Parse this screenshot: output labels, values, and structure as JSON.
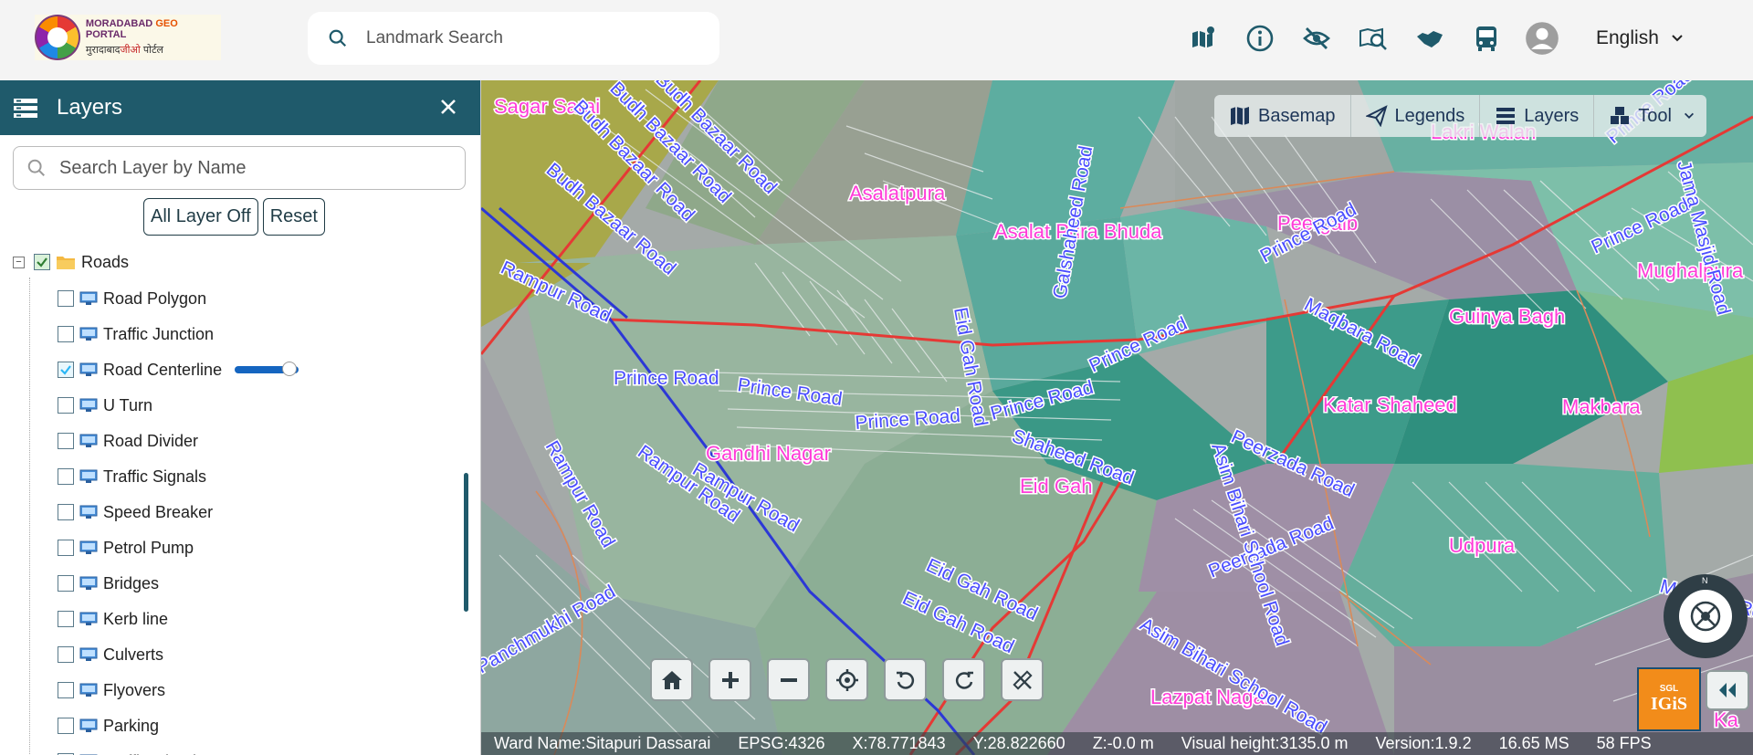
{
  "header": {
    "logo_line1_a": "MORADABAD",
    "logo_line1_b": "GEO",
    "logo_line1_c": "PORTAL",
    "logo_line2_a": "मुरादाबाद",
    "logo_line2_b": "जीओ",
    "logo_line2_c": "पोर्टल",
    "search_placeholder": "Landmark Search",
    "language": "English",
    "icons": [
      "map-pin-icon",
      "info-icon",
      "eye-off-icon",
      "map-search-icon",
      "handshake-icon",
      "bus-icon",
      "user-avatar-icon"
    ]
  },
  "panel": {
    "title": "Layers",
    "search_placeholder": "Search Layer by Name",
    "all_off_label": "All Layer Off",
    "reset_label": "Reset",
    "root_label": "Roads",
    "layers": [
      {
        "label": "Road Polygon",
        "checked": false
      },
      {
        "label": "Traffic Junction",
        "checked": false
      },
      {
        "label": "Road Centerline",
        "checked": true,
        "opacity": 0.85
      },
      {
        "label": "U Turn",
        "checked": false
      },
      {
        "label": "Road Divider",
        "checked": false
      },
      {
        "label": "Traffic Signals",
        "checked": false
      },
      {
        "label": "Speed Breaker",
        "checked": false
      },
      {
        "label": "Petrol Pump",
        "checked": false
      },
      {
        "label": "Bridges",
        "checked": false
      },
      {
        "label": "Kerb line",
        "checked": false
      },
      {
        "label": "Culverts",
        "checked": false
      },
      {
        "label": "Flyovers",
        "checked": false
      },
      {
        "label": "Parking",
        "checked": false
      },
      {
        "label": "Traffic Island",
        "checked": false
      }
    ]
  },
  "map_toolbar": {
    "basemap": "Basemap",
    "legends": "Legends",
    "layers": "Layers",
    "tool": "Tool"
  },
  "map_labels": {
    "areas": [
      "Sagar Sarai",
      "Asalatpura",
      "Asalat Pura Bhuda",
      "Peergaib",
      "Lakri Walan",
      "Mughalpura",
      "Guinya Bagh",
      "Katar Shaheed",
      "Makbara",
      "Gandhi Nagar",
      "Eid Gah",
      "Udpura",
      "Lazpat Nagar",
      "Ka"
    ],
    "roads": [
      "Budh Bazaar Road",
      "Rampur Road",
      "Prince Road",
      "Eid Gah Road",
      "Peerzada Road",
      "Panchmukhi Road",
      "Asim Bihari School Road",
      "Maqbara Road",
      "Galshaheed Road",
      "Jama Masjid Road",
      "Shaheed Road"
    ]
  },
  "compass_label": "N",
  "igis": {
    "top": "SGL",
    "name": "IGiS"
  },
  "status": {
    "ward": "Ward Name:Sitapuri Dassarai",
    "epsg": "EPSG:4326",
    "x": "X:78.771843",
    "y": "Y:28.822660",
    "z": "Z:-0.0 m",
    "visual_height": "Visual height:3135.0 m",
    "version": "Version:1.9.2",
    "ms": "16.65 MS",
    "fps": "58 FPS"
  },
  "colors": {
    "panel_header": "#1f5a6b",
    "area_label": "#ff3bd8",
    "road_label": "#4a4dff",
    "road_line": "#e53935"
  }
}
